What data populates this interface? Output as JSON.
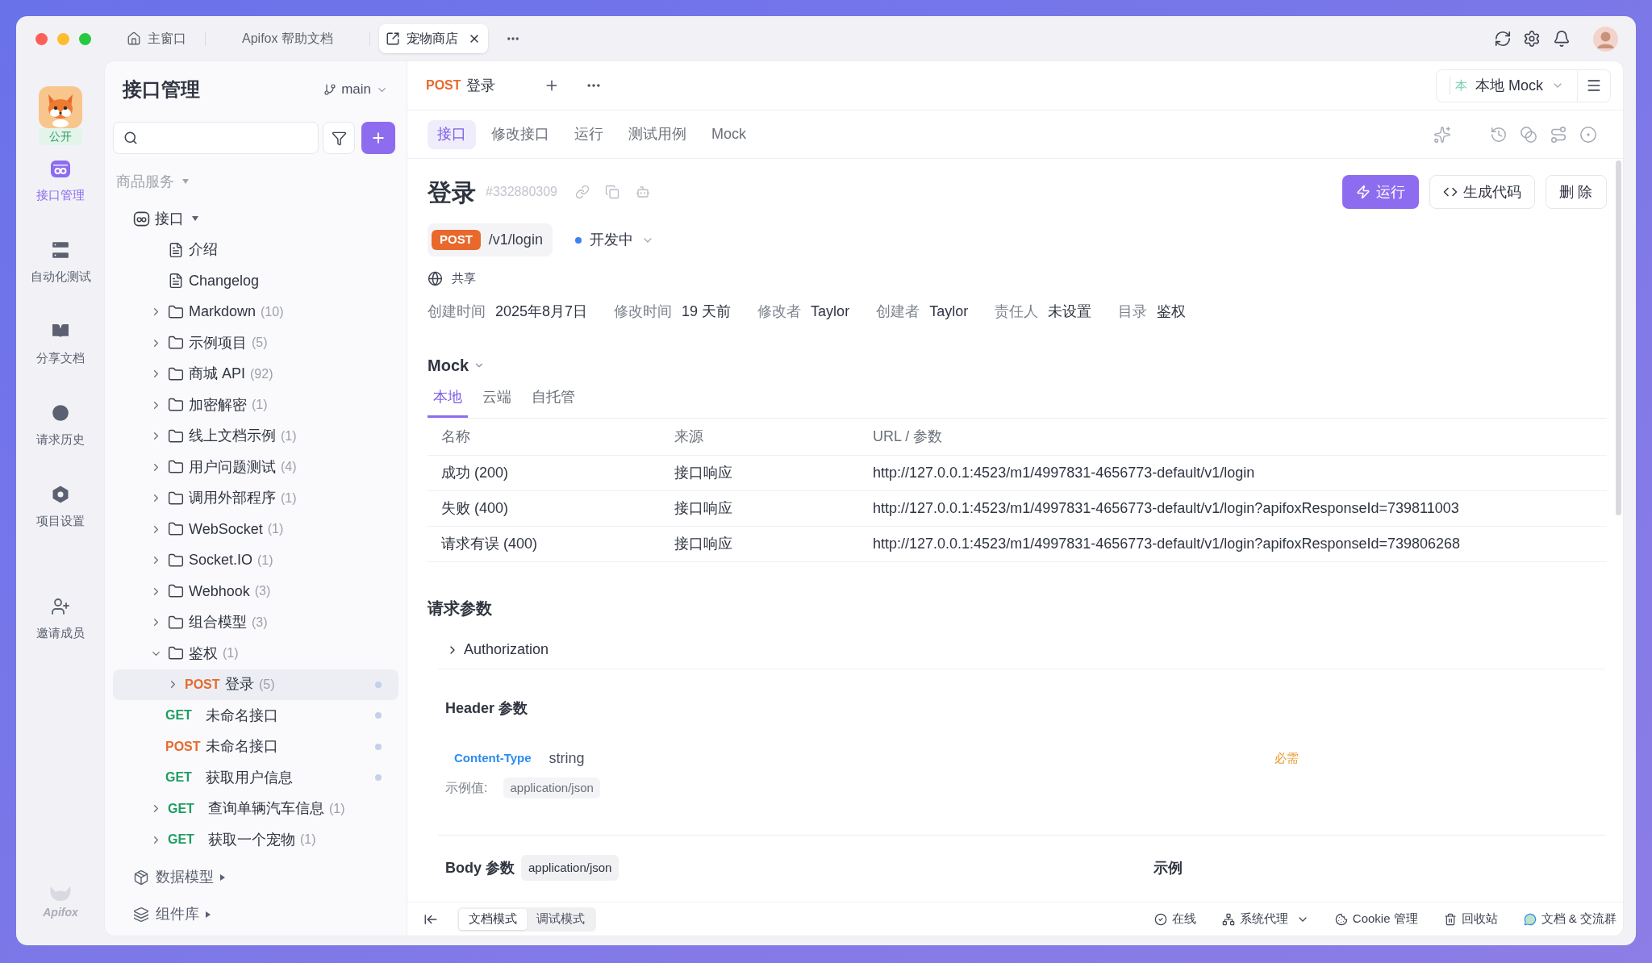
{
  "titlebar": {
    "tabs": [
      {
        "kind": "home",
        "label": "主窗口",
        "selected": false
      },
      {
        "kind": "plain",
        "label": "Apifox 帮助文档",
        "selected": false
      },
      {
        "kind": "project",
        "label": "宠物商店",
        "selected": true
      }
    ]
  },
  "rail": {
    "visibility": "公开",
    "items": [
      {
        "kind": "api",
        "label": "接口管理",
        "selected": true
      },
      {
        "kind": "automation",
        "label": "自动化测试",
        "selected": false
      },
      {
        "kind": "docs",
        "label": "分享文档",
        "selected": false
      },
      {
        "kind": "history",
        "label": "请求历史",
        "selected": false
      },
      {
        "kind": "settings",
        "label": "项目设置",
        "selected": false
      }
    ],
    "invite": {
      "kind": "invite",
      "label": "邀请成员",
      "selected": false
    },
    "footer": "Apifox"
  },
  "sidebar": {
    "title": "接口管理",
    "branch": "main",
    "service": "商品服务",
    "tree": {
      "label": "接口",
      "expanded": true,
      "children": [
        {
          "kind": "doc",
          "label": "介绍",
          "selected": false
        },
        {
          "kind": "doc",
          "label": "Changelog",
          "selected": false
        },
        {
          "kind": "folder",
          "label": "Markdown",
          "count": "(10)",
          "expanded": false,
          "selected": false
        },
        {
          "kind": "folder",
          "label": "示例项目",
          "count": "(5)",
          "expanded": false,
          "selected": false
        },
        {
          "kind": "folder",
          "label": "商城 API",
          "count": "(92)",
          "expanded": false,
          "selected": false
        },
        {
          "kind": "folder",
          "label": "加密解密",
          "count": "(1)",
          "expanded": false,
          "selected": false
        },
        {
          "kind": "folder",
          "label": "线上文档示例",
          "count": "(1)",
          "expanded": false,
          "selected": false
        },
        {
          "kind": "folder",
          "label": "用户问题测试",
          "count": "(4)",
          "expanded": false,
          "selected": false
        },
        {
          "kind": "folder",
          "label": "调用外部程序",
          "count": "(1)",
          "expanded": false,
          "selected": false
        },
        {
          "kind": "folder",
          "label": "WebSocket",
          "count": "(1)",
          "expanded": false,
          "selected": false
        },
        {
          "kind": "folder",
          "label": "Socket.IO",
          "count": "(1)",
          "expanded": false,
          "selected": false
        },
        {
          "kind": "folder",
          "label": "Webhook",
          "count": "(3)",
          "expanded": false,
          "selected": false
        },
        {
          "kind": "folder",
          "label": "组合模型",
          "count": "(3)",
          "expanded": false,
          "selected": false
        },
        {
          "kind": "folder",
          "label": "鉴权",
          "count": "(1)",
          "expanded": true,
          "selected": false,
          "children": [
            {
              "kind": "request",
              "method": "POST",
              "color": "#e8692b",
              "label": "登录",
              "count": "(5)",
              "expandable": true,
              "expanded": false,
              "selected": true,
              "status_dot": true
            },
            {
              "kind": "request",
              "method": "GET",
              "color": "#1f9d63",
              "label": "未命名接口",
              "expandable": false,
              "selected": false,
              "status_dot": true
            },
            {
              "kind": "request",
              "method": "POST",
              "color": "#e8692b",
              "label": "未命名接口",
              "expandable": false,
              "selected": false,
              "status_dot": true
            },
            {
              "kind": "request",
              "method": "GET",
              "color": "#1f9d63",
              "label": "获取用户信息",
              "expandable": false,
              "selected": false,
              "status_dot": true
            }
          ]
        },
        {
          "kind": "request",
          "method": "GET",
          "color": "#1f9d63",
          "label": "查询单辆汽车信息",
          "count": "(1)",
          "expandable": true,
          "expanded": false,
          "selected": false,
          "status_dot": false
        },
        {
          "kind": "request",
          "method": "GET",
          "color": "#1f9d63",
          "label": "获取一个宠物",
          "count": "(1)",
          "expandable": true,
          "expanded": false,
          "selected": false,
          "status_dot": false
        }
      ]
    },
    "sections": [
      {
        "kind": "models",
        "label": "数据模型",
        "expanded": false
      },
      {
        "kind": "components",
        "label": "组件库",
        "expanded": false
      }
    ]
  },
  "editor_tabs": [
    {
      "method": "POST",
      "color": "#e8692b",
      "label": "登录"
    }
  ],
  "environment": {
    "badge": "本",
    "label": "本地 Mock"
  },
  "view_tabs": [
    {
      "label": "接口",
      "selected": true
    },
    {
      "label": "修改接口",
      "selected": false
    },
    {
      "label": "运行",
      "selected": false
    },
    {
      "label": "测试用例",
      "selected": false
    },
    {
      "label": "Mock",
      "selected": false
    }
  ],
  "api": {
    "title": "登录",
    "id": "#332880309",
    "method": "POST",
    "path": "/v1/login",
    "status": "开发中",
    "sharing": "共享",
    "meta": [
      {
        "label": "创建时间",
        "value": "2025年8月7日"
      },
      {
        "label": "修改时间",
        "value": "19 天前"
      },
      {
        "label": "修改者",
        "value": "Taylor"
      },
      {
        "label": "创建者",
        "value": "Taylor"
      },
      {
        "label": "责任人",
        "value": "未设置"
      },
      {
        "label": "目录",
        "value": "鉴权"
      }
    ],
    "actions": [
      {
        "kind": "run",
        "label": "运行"
      },
      {
        "kind": "code",
        "label": "生成代码"
      },
      {
        "kind": "delete",
        "label": "删 除"
      }
    ]
  },
  "mock": {
    "title": "Mock",
    "tabs": [
      {
        "label": "本地",
        "selected": true
      },
      {
        "label": "云端",
        "selected": false
      },
      {
        "label": "自托管",
        "selected": false
      }
    ],
    "table": {
      "columns": [
        "名称",
        "来源",
        "URL / 参数"
      ],
      "rows": [
        [
          "成功 (200)",
          "接口响应",
          "http://127.0.0.1:4523/m1/4997831-4656773-default/v1/login"
        ],
        [
          "失败 (400)",
          "接口响应",
          "http://127.0.0.1:4523/m1/4997831-4656773-default/v1/login?apifoxResponseId=739811003"
        ],
        [
          "请求有误 (400)",
          "接口响应",
          "http://127.0.0.1:4523/m1/4997831-4656773-default/v1/login?apifoxResponseId=739806268"
        ]
      ]
    }
  },
  "request_params": {
    "title": "请求参数",
    "authorization": {
      "label": "Authorization",
      "expanded": false
    },
    "header": {
      "title": "Header 参数",
      "params": [
        {
          "name": "Content-Type",
          "type": "string",
          "required": "必需",
          "example_label": "示例值:",
          "example": "application/json"
        }
      ]
    },
    "body": {
      "title": "Body 参数",
      "content_type": "application/json",
      "example_title": "示例"
    }
  },
  "status_bar": {
    "modes": [
      {
        "label": "文档模式",
        "selected": true
      },
      {
        "label": "调试模式",
        "selected": false
      }
    ],
    "items": [
      {
        "kind": "online",
        "label": "在线",
        "dropdown": false
      },
      {
        "kind": "proxy",
        "label": "系统代理",
        "dropdown": true
      },
      {
        "kind": "cookie",
        "label": "Cookie 管理",
        "dropdown": false
      },
      {
        "kind": "trash",
        "label": "回收站",
        "dropdown": false
      },
      {
        "kind": "community",
        "label": "文档 & 交流群",
        "dropdown": false
      }
    ]
  }
}
